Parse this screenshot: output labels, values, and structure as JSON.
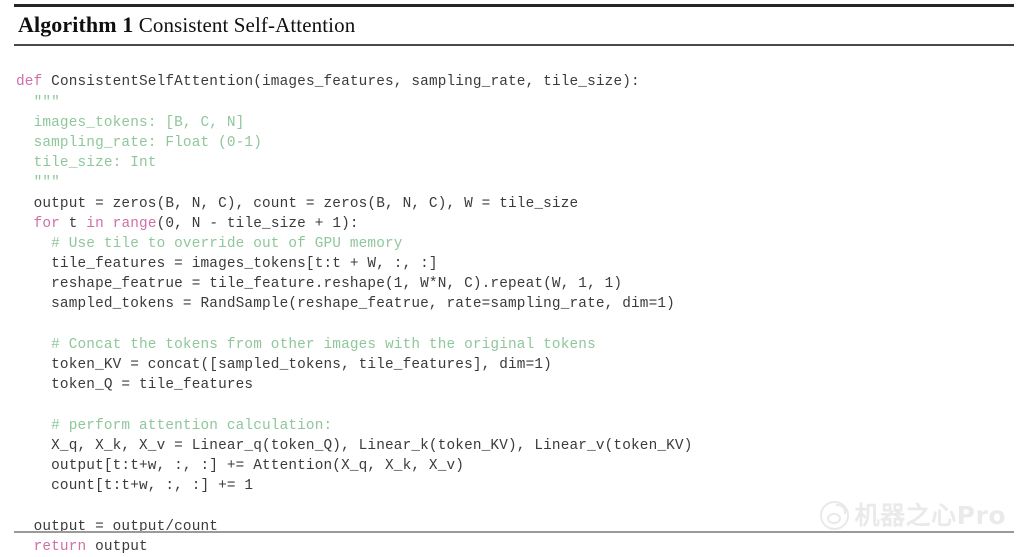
{
  "title": {
    "label": "Algorithm 1",
    "name": "Consistent Self-Attention"
  },
  "code": {
    "language": "python",
    "lines": [
      [
        {
          "t": "def ",
          "c": "kw"
        },
        {
          "t": "ConsistentSelfAttention(images_features, sampling_rate, tile_size):",
          "c": "plain"
        }
      ],
      [
        {
          "t": "  \"\"\"",
          "c": "doc"
        }
      ],
      [
        {
          "t": "  images_tokens: [B, C, N]",
          "c": "doc"
        }
      ],
      [
        {
          "t": "  sampling_rate: Float (0-1)",
          "c": "doc"
        }
      ],
      [
        {
          "t": "  tile_size: Int",
          "c": "doc"
        }
      ],
      [
        {
          "t": "  \"\"\"",
          "c": "doc"
        }
      ],
      [
        {
          "t": "  output = zeros(B, N, C), count = zeros(B, N, C), W = tile_size",
          "c": "plain"
        }
      ],
      [
        {
          "t": "  ",
          "c": "plain"
        },
        {
          "t": "for",
          "c": "kw"
        },
        {
          "t": " t ",
          "c": "plain"
        },
        {
          "t": "in",
          "c": "kw"
        },
        {
          "t": " ",
          "c": "plain"
        },
        {
          "t": "range",
          "c": "kw"
        },
        {
          "t": "(0, N - tile_size + 1):",
          "c": "plain"
        }
      ],
      [
        {
          "t": "    # Use tile to override out of GPU memory",
          "c": "comment"
        }
      ],
      [
        {
          "t": "    tile_features = images_tokens[t:t + W, :, :]",
          "c": "plain"
        }
      ],
      [
        {
          "t": "    reshape_featrue = tile_feature.reshape(1, W*N, C).repeat(W, 1, 1)",
          "c": "plain"
        }
      ],
      [
        {
          "t": "    sampled_tokens = RandSample(reshape_featrue, rate=sampling_rate, dim=1)",
          "c": "plain"
        }
      ],
      [],
      [
        {
          "t": "    # Concat the tokens from other images with the original tokens",
          "c": "comment"
        }
      ],
      [
        {
          "t": "    token_KV = concat([sampled_tokens, tile_features], dim=1)",
          "c": "plain"
        }
      ],
      [
        {
          "t": "    token_Q = tile_features",
          "c": "plain"
        }
      ],
      [],
      [
        {
          "t": "    # perform attention calculation:",
          "c": "comment"
        }
      ],
      [
        {
          "t": "    X_q, X_k, X_v = Linear_q(token_Q), Linear_k(token_KV), Linear_v(token_KV)",
          "c": "plain"
        }
      ],
      [
        {
          "t": "    output[t:t+w, :, :] += Attention(X_q, X_k, X_v)",
          "c": "plain"
        }
      ],
      [
        {
          "t": "    count[t:t+w, :, :] += 1",
          "c": "plain"
        }
      ],
      [],
      [
        {
          "t": "  output = output/count",
          "c": "plain"
        }
      ],
      [
        {
          "t": "  ",
          "c": "plain"
        },
        {
          "t": "return",
          "c": "kw"
        },
        {
          "t": " output",
          "c": "plain"
        }
      ]
    ]
  },
  "watermark": {
    "text": "机器之心Pro",
    "logo": "weibo-icon"
  },
  "colors": {
    "keyword": "#d16fa8",
    "comment": "#8fc79a",
    "docstring": "#8fc79a",
    "plain": "#3b3b3b",
    "rule": "#262626",
    "background": "#ffffff"
  }
}
